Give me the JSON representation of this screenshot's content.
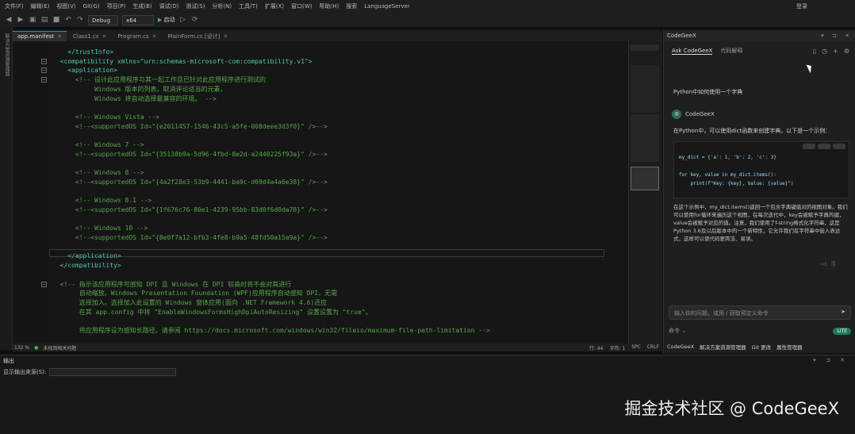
{
  "menu": [
    "文件(F)",
    "编辑(E)",
    "视图(V)",
    "Git(G)",
    "项目(P)",
    "生成(B)",
    "调试(D)",
    "测试(S)",
    "分析(N)",
    "工具(T)",
    "扩展(X)",
    "窗口(W)",
    "帮助(H)",
    "搜索",
    "LanguageServer",
    "登录"
  ],
  "toolbar": {
    "config": "Debug",
    "platform": "x64",
    "run_label": "启动"
  },
  "left_strip_label": "解决方案资源管理器",
  "tabs": [
    {
      "label": "app.manifest",
      "active": true
    },
    {
      "label": "Class1.cs",
      "active": false
    },
    {
      "label": "Program.cs",
      "active": false
    },
    {
      "label": "MainForm.cs [设计]",
      "active": false
    }
  ],
  "code_lines": [
    {
      "text": "    </trustInfo>",
      "kind": "tag"
    },
    {
      "text": "  <compatibility xmlns=\"urn:schemas-microsoft-com:compatibility.v1\">",
      "kind": "tag"
    },
    {
      "text": "    <application>",
      "kind": "tag"
    },
    {
      "text": "      <!-- 设计此应用程序与其一起工作且已针对此应用程序进行测试的",
      "kind": "cmt"
    },
    {
      "text": "           Windows 版本的列表。取消评论适当的元素，",
      "kind": "cmt"
    },
    {
      "text": "           Windows 将自动选择最兼容的环境。 -->",
      "kind": "cmt"
    },
    {
      "text": "",
      "kind": "cmt"
    },
    {
      "text": "      <!-- Windows Vista -->",
      "kind": "cmt"
    },
    {
      "text": "      <!--<supportedOS Id=\"{e2011457-1546-43c5-a5fe-008deee3d3f0}\" />-->",
      "kind": "cmt"
    },
    {
      "text": "",
      "kind": "cmt"
    },
    {
      "text": "      <!-- Windows 7 -->",
      "kind": "cmt"
    },
    {
      "text": "      <!--<supportedOS Id=\"{35138b9a-5d96-4fbd-8e2d-a2440225f93a}\" />-->",
      "kind": "cmt"
    },
    {
      "text": "",
      "kind": "cmt"
    },
    {
      "text": "      <!-- Windows 8 -->",
      "kind": "cmt"
    },
    {
      "text": "      <!--<supportedOS Id=\"{4a2f28e3-53b9-4441-ba9c-d69d4a4a6e38}\" />-->",
      "kind": "cmt"
    },
    {
      "text": "",
      "kind": "cmt"
    },
    {
      "text": "      <!-- Windows 8.1 -->",
      "kind": "cmt"
    },
    {
      "text": "      <!--<supportedOS Id=\"{1f676c76-80e1-4239-95bb-83d0f6d0da78}\" />-->",
      "kind": "cmt"
    },
    {
      "text": "",
      "kind": "cmt"
    },
    {
      "text": "      <!-- Windows 10 -->",
      "kind": "cmt"
    },
    {
      "text": "      <!--<supportedOS Id=\"{8e0f7a12-bfb3-4fe8-b9a5-48fd50a15a9a}\" />-->",
      "kind": "cmt"
    },
    {
      "text": "",
      "kind": "cmt"
    },
    {
      "text": "    </application>",
      "kind": "tag"
    },
    {
      "text": "  </compatibility>",
      "kind": "tag"
    },
    {
      "text": "",
      "kind": "cmt"
    },
    {
      "text": "  <!-- 指示该应用程序可感知 DPI 且 Windows 在 DPI 较高时将不会对其进行",
      "kind": "cmt"
    },
    {
      "text": "       自动缩放。Windows Presentation Foundation (WPF)应用程序自动感知 DPI，无需",
      "kind": "cmt"
    },
    {
      "text": "       选择加入。选择加入此设置的 Windows 窗体应用(面向 .NET Framework 4.6)还应",
      "kind": "cmt"
    },
    {
      "text": "       在其 app.config 中将 \"EnableWindowsFormsHighDpiAutoResizing\" 设置设置为 \"true\"。",
      "kind": "cmt"
    },
    {
      "text": "",
      "kind": "cmt"
    },
    {
      "text": "       将应用程序设为感知长路径。请参阅 https://docs.microsoft.com/windows/win32/fileio/maximum-file-path-limitation -->",
      "kind": "cmt"
    }
  ],
  "status": {
    "zoom": "132 %",
    "issues": "未找到相关问题",
    "line": "行: 44",
    "char": "字符: 1",
    "spc": "SPC",
    "crlf": "CRLF"
  },
  "codegeex": {
    "panel_title": "CodeGeeX",
    "tab_ask": "Ask CodeGeeX",
    "tab_other": "代码解释",
    "question": "Python中如何使用一个字典",
    "bot_name": "CodeGeeX",
    "answer_intro": "在Python中，可以使用dict函数来创建字典。以下是一个示例：",
    "code": [
      "my_dict = {'a': 1, 'b': 2, 'c': 3}",
      "",
      "for key, value in my_dict.items():",
      "    print(f\"Key: {key}, Value: {value}\")"
    ],
    "answer_body": "在这个示例中，my_dict.items()返回一个包含字典键值对的视图对象。我们可以使用for循环来遍历这个视图，在每次迭代中，key会被赋予字典的键，value会被赋予对应的值。注意，我们使用了f-string格式化字符串，这是Python 3.6及以后版本中的一个新特性，它允许我们在字符串中嵌入表达式，这样可以使代码更简洁、易读。",
    "input_placeholder": "输入你的问题，或用 / 获取预定义命令",
    "footer_left": "命令 ⌄",
    "lite_badge": "LITE",
    "bottom_tabs": [
      "CodeGeeX",
      "解决方案资源管理器",
      "Git 更改",
      "属性管理器"
    ]
  },
  "output": {
    "title": "输出",
    "source_label": "显示输出来源(S):"
  },
  "watermark": "掘金技术社区 @ CodeGeeX"
}
